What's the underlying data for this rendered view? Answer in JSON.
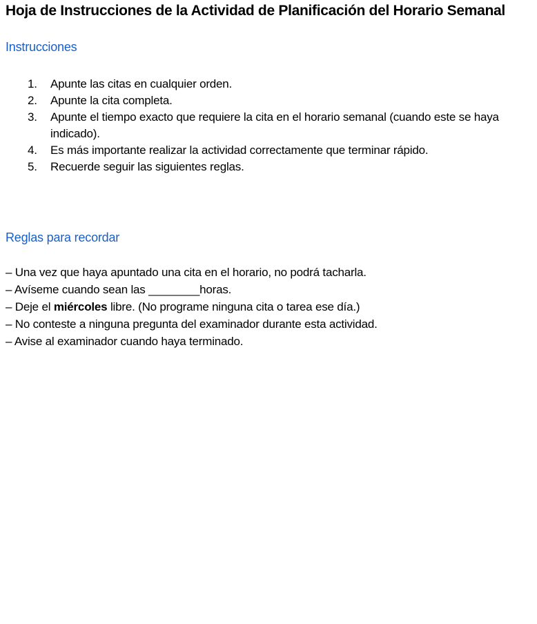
{
  "document": {
    "title": "Hoja de Instrucciones de la Actividad de Planificación del Horario Semanal",
    "instructions_heading": "Instrucciones",
    "instructions": [
      {
        "num": "1.",
        "text": "Apunte las citas en cualquier orden."
      },
      {
        "num": "2.",
        "text": "Apunte la cita completa."
      },
      {
        "num": "3.",
        "text": "Apunte el tiempo exacto que requiere la cita en el horario semanal (cuando este se haya indicado)."
      },
      {
        "num": "4.",
        "text": "Es más importante realizar la actividad correctamente que terminar rápido."
      },
      {
        "num": "5.",
        "text": "Recuerde seguir las siguientes reglas."
      }
    ],
    "rules_heading": "Reglas para recordar",
    "rules": {
      "r1": "– Una vez que haya apuntado una cita en el horario, no podrá tacharla.",
      "r2": "– Avíseme cuando sean las ________horas.",
      "r3_pre": "– Deje el ",
      "r3_bold": "miércoles",
      "r3_post": " libre. (No programe ninguna cita o tarea ese día.)",
      "r4": "– No conteste a ninguna pregunta del examinador durante esta actividad.",
      "r5": "– Avise al examinador cuando haya terminado."
    }
  },
  "colors": {
    "heading_blue": "#1a5fc8",
    "text": "#000000",
    "background": "#ffffff"
  }
}
